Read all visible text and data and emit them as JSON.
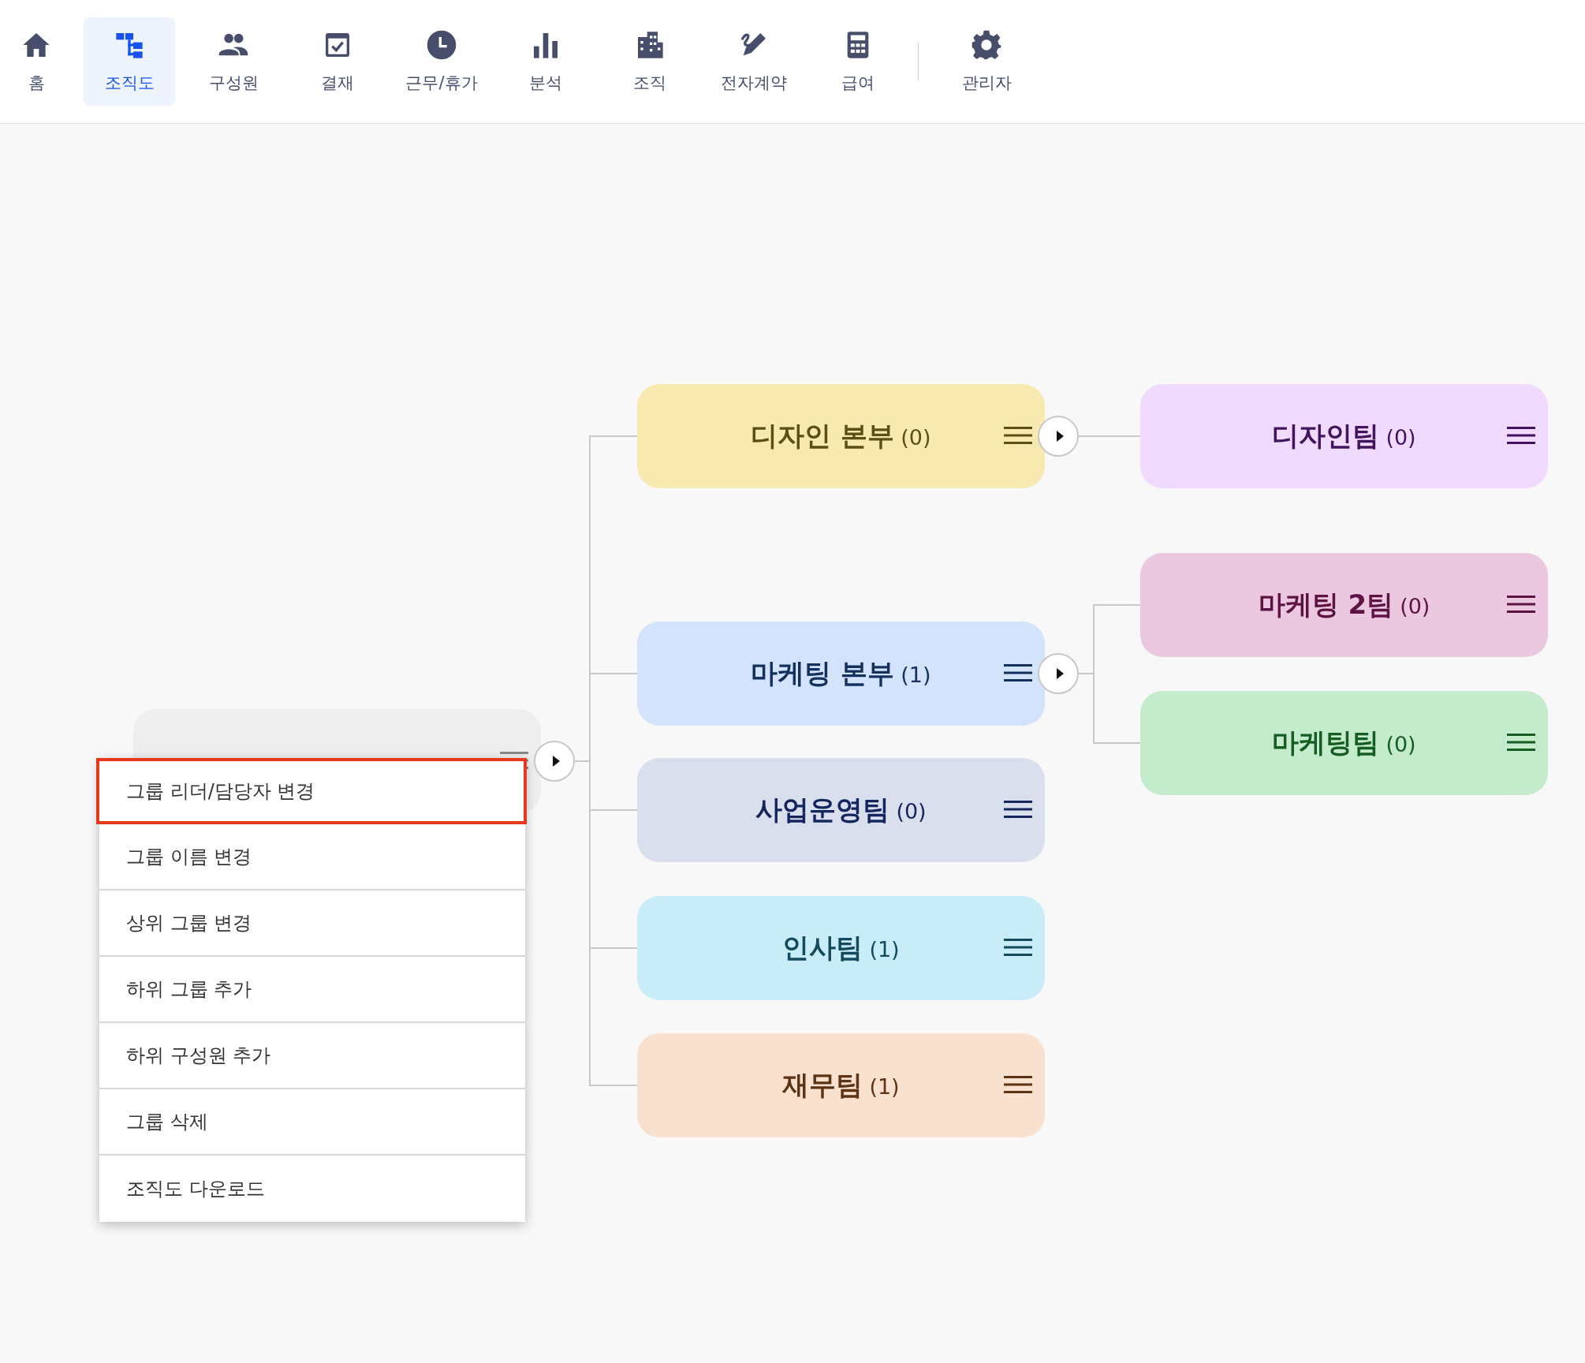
{
  "nav": {
    "items": [
      {
        "label": "홈",
        "kind": "home",
        "selected": false
      },
      {
        "label": "조직도",
        "kind": "org",
        "selected": true
      },
      {
        "label": "구성원",
        "kind": "people",
        "selected": false
      },
      {
        "label": "결재",
        "kind": "approval",
        "selected": false
      },
      {
        "label": "근무/휴가",
        "kind": "clock",
        "selected": false
      },
      {
        "label": "분석",
        "kind": "chart",
        "selected": false
      },
      {
        "label": "조직",
        "kind": "building",
        "selected": false
      },
      {
        "label": "전자계약",
        "kind": "sign",
        "selected": false
      },
      {
        "label": "급여",
        "kind": "calculator",
        "selected": false
      },
      {
        "label": "관리자",
        "kind": "gear",
        "selected": false,
        "separated": true
      }
    ]
  },
  "org_chart": {
    "root": {
      "color": "#eeeeee",
      "children": [
        {
          "name": "디자인 본부",
          "count": "(0)",
          "color": "#f8e9b0",
          "children": [
            {
              "name": "디자인팀",
              "count": "(0)",
              "color": "#f0dafd"
            }
          ]
        },
        {
          "name": "마케팅 본부",
          "count": "(1)",
          "color": "#d3e3fb",
          "children": [
            {
              "name": "마케팅 2팀",
              "count": "(0)",
              "color": "#ebc8e0"
            },
            {
              "name": "마케팅팀",
              "count": "(0)",
              "color": "#c5ebcd"
            }
          ]
        },
        {
          "name": "사업운영팀",
          "count": "(0)",
          "color": "#dadfee"
        },
        {
          "name": "인사팀",
          "count": "(1)",
          "color": "#c8ecf8"
        },
        {
          "name": "재무팀",
          "count": "(1)",
          "color": "#f9e1cf"
        }
      ]
    }
  },
  "context_menu": {
    "items": [
      {
        "label": "그룹 리더/담당자 변경",
        "selected": true
      },
      {
        "label": "그룹 이름 변경",
        "selected": false
      },
      {
        "label": "상위 그룹 변경",
        "selected": false
      },
      {
        "label": "하위 그룹 추가",
        "selected": false
      },
      {
        "label": "하위 구성원 추가",
        "selected": false
      },
      {
        "label": "그룹 삭제",
        "selected": false
      },
      {
        "label": "조직도 다운로드",
        "selected": false
      }
    ]
  }
}
